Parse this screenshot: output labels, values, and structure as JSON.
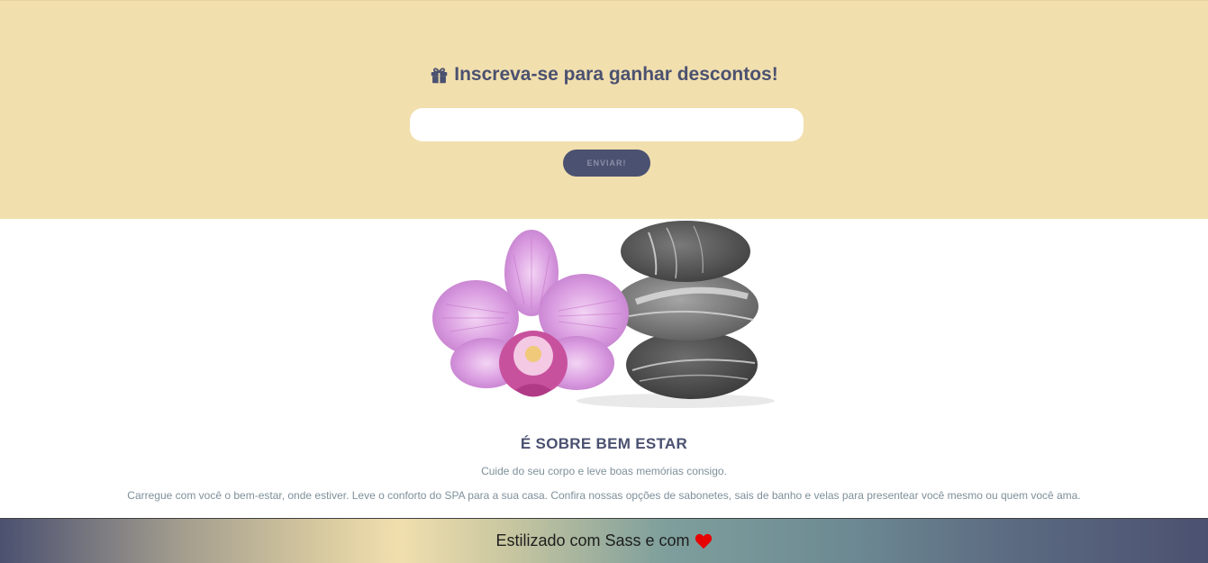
{
  "newsletter": {
    "title": "Inscreva-se para ganhar descontos!",
    "title_icon": "gift-icon",
    "email_value": "",
    "email_placeholder": "",
    "submit_label": "ENVIAR!"
  },
  "hero": {
    "image": "orchid-and-stacked-stones"
  },
  "about": {
    "title": "É SOBRE BEM ESTAR",
    "subtitle": "Cuide do seu corpo e leve boas memórias consigo.",
    "text": "Carregue com você o bem-estar, onde estiver. Leve o conforto do SPA para a sua casa. Confira nossas opções de sabonetes, sais de banho e velas para presentear você mesmo ou quem você ama."
  },
  "footer": {
    "text": "Estilizado com Sass e com",
    "icon": "heart-icon"
  },
  "colors": {
    "banner_background": "#f1dfae",
    "accent_navy": "#4b5170",
    "body_text": "#7f909a",
    "heart": "#e60000"
  }
}
